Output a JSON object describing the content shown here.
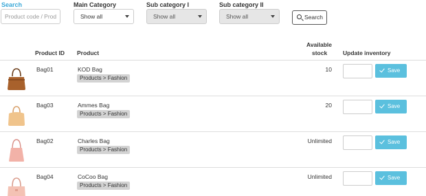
{
  "filters": {
    "search": {
      "label": "Search",
      "placeholder": "Product code / Product name"
    },
    "main_category": {
      "label": "Main Category",
      "value": "Show all"
    },
    "sub_category_1": {
      "label": "Sub category I",
      "value": "Show all"
    },
    "sub_category_2": {
      "label": "Sub category II",
      "value": "Show all"
    },
    "search_button": "Search",
    "accent_color": "#3aa8d8"
  },
  "table": {
    "headers": {
      "product_id": "Product ID",
      "product": "Product",
      "stock_line1": "Available",
      "stock_line2": "stock",
      "update": "Update inventory"
    },
    "rows": [
      {
        "id": "Bag01",
        "name": "KOD Bag",
        "category": "Products > Fashion",
        "stock": "10",
        "save": "Save",
        "thumb_color": "#a8612c"
      },
      {
        "id": "Bag03",
        "name": "Ammes Bag",
        "category": "Products > Fashion",
        "stock": "20",
        "save": "Save",
        "thumb_color": "#f0c48c"
      },
      {
        "id": "Bag02",
        "name": "Charles Bag",
        "category": "Products > Fashion",
        "stock": "Unlimited",
        "save": "Save",
        "thumb_color": "#f2b2a8"
      },
      {
        "id": "Bag04",
        "name": "CoCoo Bag",
        "category": "Products > Fashion",
        "stock": "Unlimited",
        "save": "Save",
        "thumb_color": "#f4c2b4"
      }
    ]
  },
  "save_button_color": "#5bc0de"
}
